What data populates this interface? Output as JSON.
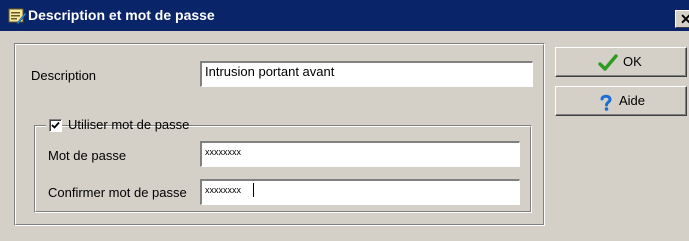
{
  "window": {
    "title": "Description et mot de passe",
    "close_glyph": "✕",
    "title_icon": "form-edit-icon"
  },
  "form": {
    "description_label": "Description",
    "description_value": "Intrusion portant avant",
    "use_password_label": "Utiliser mot de passe",
    "use_password_checked": true,
    "password_label": "Mot de passe",
    "password_value": "xxxxxxxx",
    "confirm_label": "Confirmer mot de passe",
    "confirm_value": "xxxxxxxx"
  },
  "buttons": {
    "ok_label": "OK",
    "ok_icon": "checkmark-icon",
    "help_label": "Aide",
    "help_icon": "question-mark-icon"
  },
  "colors": {
    "titlebar": "#0a246a",
    "dialog_face": "#d4d0c8",
    "ok_check": "#2e9a1e",
    "help_question": "#1a6fd6"
  }
}
